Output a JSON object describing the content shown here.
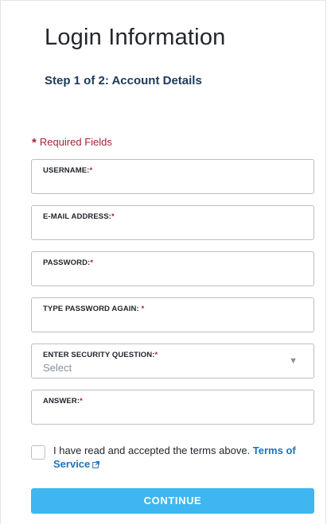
{
  "header": {
    "title": "Login Information",
    "step": "Step 1 of 2: Account Details"
  },
  "required_note": {
    "star": "*",
    "text": "Required Fields"
  },
  "fields": [
    {
      "label": "USERNAME:",
      "req": "*",
      "value": ""
    },
    {
      "label": "E-MAIL ADDRESS:",
      "req": "*",
      "value": ""
    },
    {
      "label": "PASSWORD:",
      "req": "*",
      "value": ""
    },
    {
      "label": "TYPE PASSWORD AGAIN: ",
      "req": "*",
      "value": ""
    },
    {
      "label": "ENTER SECURITY QUESTION:",
      "req": "*",
      "selected": "Select",
      "caret": "▼"
    },
    {
      "label": "ANSWER:",
      "req": "*",
      "value": ""
    }
  ],
  "terms": {
    "checked": false,
    "text": "I have read and accepted the terms above.",
    "link_label": "Terms of Service"
  },
  "actions": {
    "continue_label": "CONTINUE"
  },
  "colors": {
    "accent": "#3fb6ef",
    "required": "#a3253a",
    "link": "#1e73be",
    "step": "#1b3a5b"
  }
}
